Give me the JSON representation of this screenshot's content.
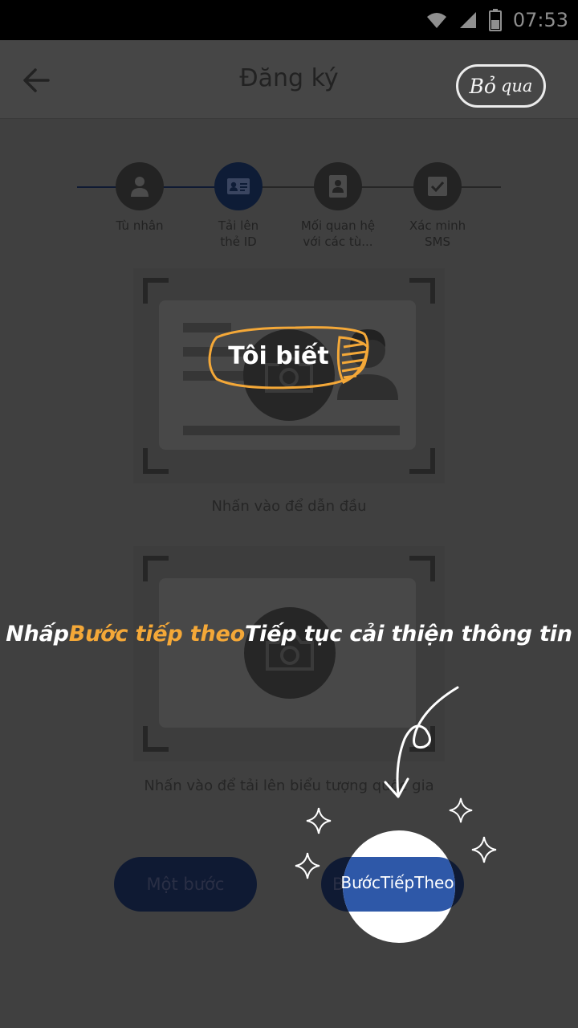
{
  "status_bar": {
    "time": "07:53"
  },
  "header": {
    "title": "Đăng ký",
    "skip_main": "Bỏ",
    "skip_sub": "qua"
  },
  "stepper": {
    "steps": [
      {
        "line1": "Tù nhân",
        "line2": ""
      },
      {
        "line1": "Tải lên",
        "line2": "thẻ ID"
      },
      {
        "line1": "Mối quan hệ",
        "line2": "với các tù..."
      },
      {
        "line1": "Xác minh",
        "line2": "SMS"
      }
    ]
  },
  "upload": {
    "front_caption": "Nhấn vào để dẫn đầu",
    "back_caption": "Nhấn vào để tải lên biểu tượng quốc gia"
  },
  "tooltip": {
    "got_it": "Tôi biết"
  },
  "instruction": {
    "prefix": "Nhấp",
    "highlight": "Bước tiếp theo",
    "suffix": "Tiếp tục cải thiện thông tin"
  },
  "buttons": {
    "prev": "Một bước",
    "next_bg": "B",
    "next": "BướcTiếpTheo"
  },
  "colors": {
    "highlight": "#f4a838",
    "primary": "#2e58a8",
    "overlay": "#404040"
  }
}
